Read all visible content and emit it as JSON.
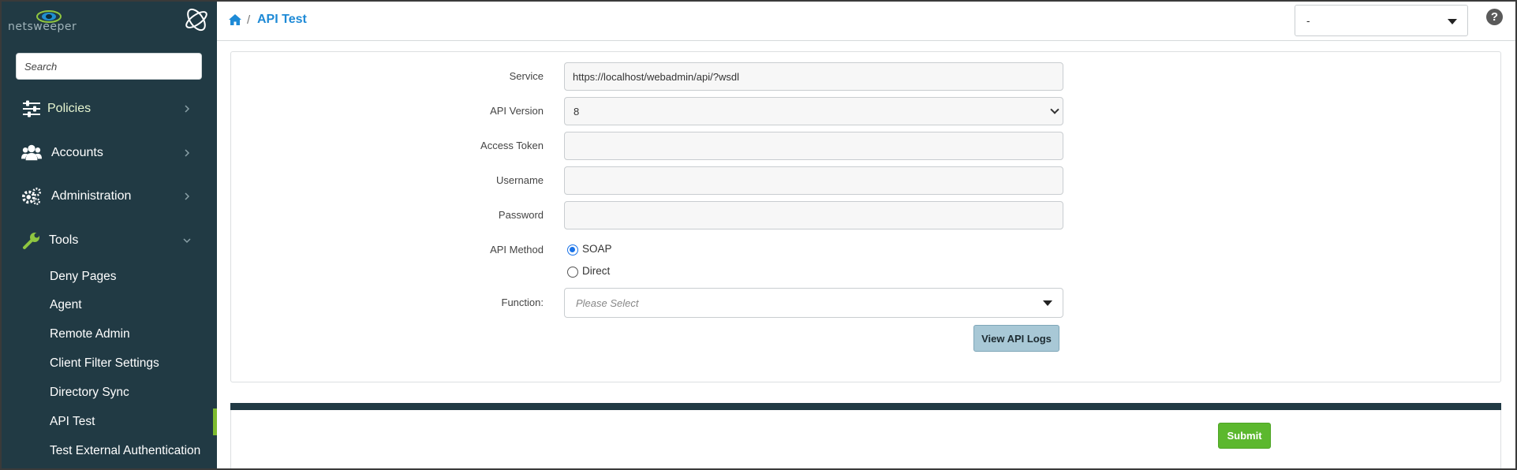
{
  "brand": {
    "name": "netsweeper"
  },
  "sidebar": {
    "search_placeholder": "Search",
    "items": [
      {
        "label": "Policies",
        "icon": "sliders-icon"
      },
      {
        "label": "Accounts",
        "icon": "users-icon"
      },
      {
        "label": "Administration",
        "icon": "gears-icon"
      },
      {
        "label": "Tools",
        "icon": "wrench-icon"
      }
    ],
    "tools_subitems": [
      "Deny Pages",
      "Agent",
      "Remote Admin",
      "Client Filter Settings",
      "Directory Sync",
      "API Test",
      "Test External Authentication"
    ],
    "active_subitem": "API Test",
    "accent_color": "#7dbb2f"
  },
  "header": {
    "breadcrumb_separator": "/",
    "title": "API Test",
    "select_value": "-",
    "help_glyph": "?"
  },
  "form": {
    "service": {
      "label": "Service",
      "value": "https://localhost/webadmin/api/?wsdl"
    },
    "api_version": {
      "label": "API Version",
      "value": "8"
    },
    "access_token": {
      "label": "Access Token",
      "value": ""
    },
    "username": {
      "label": "Username",
      "value": ""
    },
    "password": {
      "label": "Password",
      "value": ""
    },
    "api_method": {
      "label": "API Method",
      "options": [
        "SOAP",
        "Direct"
      ],
      "selected": "SOAP"
    },
    "function": {
      "label": "Function:",
      "placeholder": "Please Select"
    },
    "view_logs_label": "View API Logs"
  },
  "footer": {
    "submit_label": "Submit"
  },
  "colors": {
    "sidebar_bg": "#213a44",
    "link_blue": "#1e8ad6",
    "submit_green": "#5cb82e",
    "logs_button": "#a8c8d6"
  }
}
